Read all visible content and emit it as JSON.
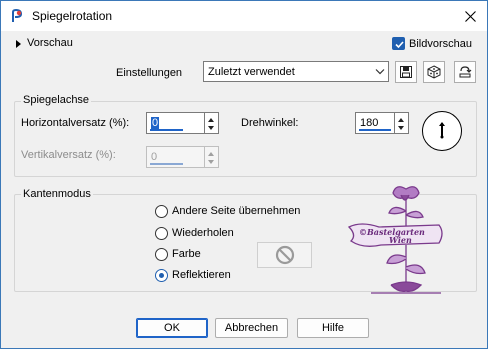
{
  "window": {
    "title": "Spiegelrotation",
    "icon": "app-logo-icon"
  },
  "preview": {
    "toggle_label": "Vorschau",
    "checkbox_label": "Bildvorschau",
    "checked": true
  },
  "settings": {
    "label": "Einstellungen",
    "value": "Zuletzt verwendet",
    "icons": [
      "save-icon",
      "dice-icon",
      "reset-icon"
    ]
  },
  "mirror_axis": {
    "group_label": "Spiegelachse",
    "horizontal_label": "Horizontalversatz (%):",
    "horizontal_value": "0",
    "vertical_label": "Vertikalversatz (%):",
    "vertical_value": "0",
    "rotation_label": "Drehwinkel:",
    "rotation_value": "180"
  },
  "edge_mode": {
    "group_label": "Kantenmodus",
    "options": [
      "Andere Seite übernehmen",
      "Wiederholen",
      "Farbe",
      "Reflektieren"
    ],
    "selected": "Reflektieren"
  },
  "watermark": {
    "line1": "©Bastelgarten",
    "line2": "Wien",
    "color": "#8a4a9a"
  },
  "buttons": {
    "ok": "OK",
    "cancel": "Abbrechen",
    "help": "Hilfe"
  },
  "colors": {
    "accent": "#1f5fb0",
    "window_border": "#3b78b8"
  }
}
